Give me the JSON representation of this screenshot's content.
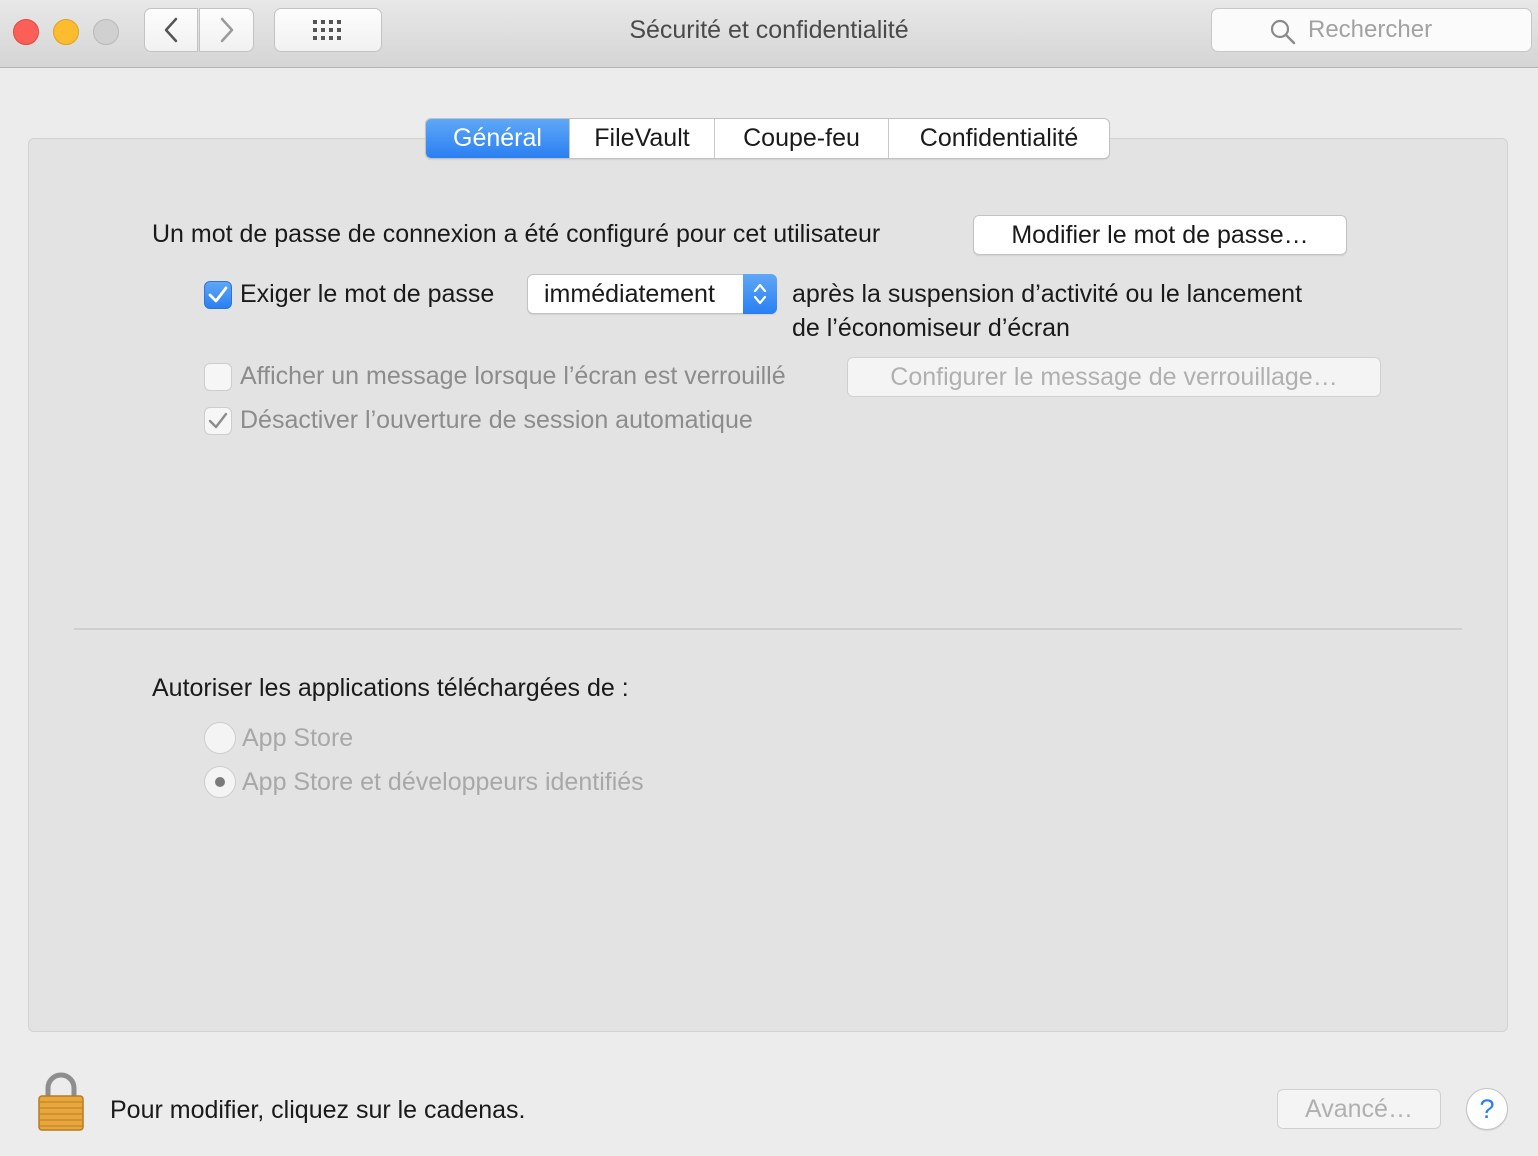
{
  "window": {
    "title": "Sécurité et confidentialité",
    "search_placeholder": "Rechercher"
  },
  "tabs": [
    {
      "label": "Général",
      "active": true
    },
    {
      "label": "FileVault",
      "active": false
    },
    {
      "label": "Coupe-feu",
      "active": false
    },
    {
      "label": "Confidentialité",
      "active": false
    }
  ],
  "general": {
    "password_status": "Un mot de passe de connexion a été configuré pour cet utilisateur",
    "change_password_button": "Modifier le mot de passe…",
    "require_password": {
      "checked": true,
      "label": "Exiger le mot de passe",
      "delay_value": "immédiatement",
      "after_text_line1": "après la suspension d’activité ou le lancement",
      "after_text_line2": "de l’économiseur d’écran"
    },
    "show_message": {
      "checked": false,
      "label": "Afficher un message lorsque l’écran est verrouillé",
      "configure_button": "Configurer le message de verrouillage…"
    },
    "disable_auto_login": {
      "checked": true,
      "label": "Désactiver l’ouverture de session automatique"
    }
  },
  "downloads": {
    "heading": "Autoriser les applications téléchargées de :",
    "options": [
      {
        "label": "App Store",
        "selected": false
      },
      {
        "label": "App Store et développeurs identifiés",
        "selected": true
      }
    ]
  },
  "footer": {
    "lock_text": "Pour modifier, cliquez sur le cadenas.",
    "advanced_button": "Avancé…",
    "help_label": "?"
  },
  "colors": {
    "accent": "#2a7ff2",
    "close": "#fc5f57",
    "minimize": "#fdbc2e"
  }
}
